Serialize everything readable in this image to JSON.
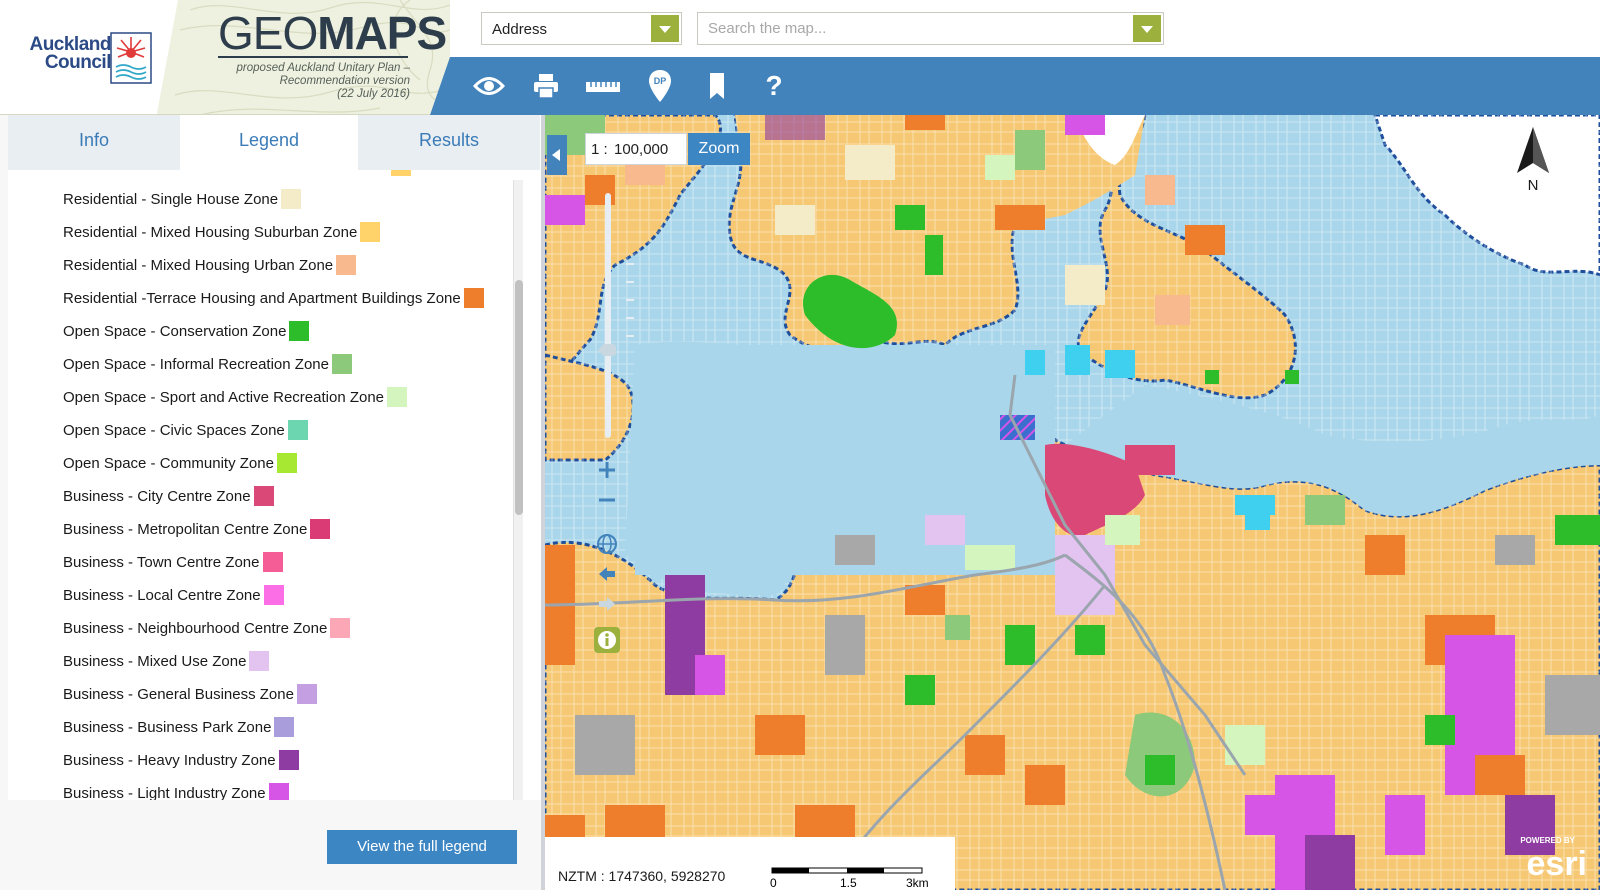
{
  "header": {
    "council_line1": "Auckland",
    "council_line2": "Council",
    "geomaps_light": "GEO",
    "geomaps_bold": "MAPS",
    "plan_line1": "proposed Auckland Unitary Plan –",
    "plan_line2": "Recommendation version",
    "plan_line3": "(22 July 2016)"
  },
  "search": {
    "address_value": "Address",
    "search_placeholder": "Search the map..."
  },
  "toolbar": {
    "tools": [
      "eye-icon",
      "print-icon",
      "ruler-icon",
      "dp-pin-icon",
      "bookmark-icon",
      "help-icon"
    ],
    "dp_label": "DP",
    "help_label": "?"
  },
  "tabs": {
    "info": "Info",
    "legend": "Legend",
    "results": "Results",
    "active": "legend"
  },
  "legend": {
    "items": [
      {
        "label": "Residential - Single House Zone",
        "color": "#f4ebc8"
      },
      {
        "label": "Residential - Mixed Housing Suburban Zone",
        "color": "#ffd369"
      },
      {
        "label": "Residential - Mixed Housing Urban Zone",
        "color": "#f7b98d"
      },
      {
        "label": "Residential -Terrace Housing and Apartment Buildings Zone",
        "color": "#ee7d2c"
      },
      {
        "label": "Open Space - Conservation Zone",
        "color": "#2ebd2a"
      },
      {
        "label": "Open Space - Informal Recreation Zone",
        "color": "#8dc97b"
      },
      {
        "label": "Open Space - Sport and Active Recreation Zone",
        "color": "#d5f5be"
      },
      {
        "label": "Open Space - Civic Spaces Zone",
        "color": "#6cd6b0"
      },
      {
        "label": "Open Space - Community Zone",
        "color": "#a6e832"
      },
      {
        "label": "Business - City Centre Zone",
        "color": "#d94876"
      },
      {
        "label": "Business - Metropolitan Centre Zone",
        "color": "#db3b74"
      },
      {
        "label": "Business - Town Centre Zone",
        "color": "#f55d96"
      },
      {
        "label": "Business - Local Centre Zone",
        "color": "#fb6ee6"
      },
      {
        "label": "Business - Neighbourhood Centre Zone",
        "color": "#fca7b6"
      },
      {
        "label": "Business - Mixed Use Zone",
        "color": "#e3c3f0"
      },
      {
        "label": "Business - General Business Zone",
        "color": "#c4a0e3"
      },
      {
        "label": "Business - Business Park Zone",
        "color": "#a99ddc"
      },
      {
        "label": "Business - Heavy Industry Zone",
        "color": "#8e3ca1"
      },
      {
        "label": "Business - Light Industry Zone",
        "color": "#d655e6"
      }
    ],
    "full_legend_button": "View the full legend"
  },
  "map": {
    "scale_prefix": "1 :",
    "scale_value": "100,000",
    "zoom_button": "Zoom",
    "north_label": "N",
    "coordinates": "NZTM : 1747360, 5928270",
    "scalebar_labels": [
      "0",
      "1.5",
      "3km"
    ],
    "esri_powered": "POWERED BY",
    "esri_brand": "esri",
    "colors": {
      "water": "#a9d6ea",
      "coast": "#1f4f9c",
      "port": "#3fd0f0"
    }
  }
}
